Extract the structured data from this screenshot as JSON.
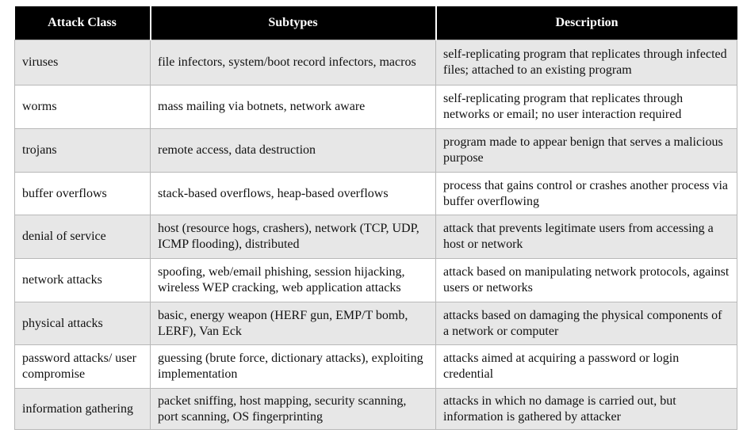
{
  "table": {
    "headers": [
      "Attack Class",
      "Subtypes",
      "Description"
    ],
    "rows": [
      {
        "attack_class": "viruses",
        "subtypes": "file infectors, system/boot record infectors, macros",
        "description": "self-replicating program that replicates through infected files; attached to an existing program"
      },
      {
        "attack_class": "worms",
        "subtypes": "mass mailing via botnets, network aware",
        "description": "self-replicating program that replicates through networks or email; no user interaction required"
      },
      {
        "attack_class": "trojans",
        "subtypes": "remote access, data destruction",
        "description": "program made to appear benign that serves a malicious purpose"
      },
      {
        "attack_class": "buffer overflows",
        "subtypes": "stack-based overflows, heap-based overflows",
        "description": "process that gains control or crashes another process via buffer overflowing"
      },
      {
        "attack_class": "denial of service",
        "subtypes": "host (resource hogs, crashers), network (TCP, UDP, ICMP flooding), distributed",
        "description": "attack that prevents legitimate users from accessing a host or network"
      },
      {
        "attack_class": "network attacks",
        "subtypes": "spoofing, web/email phishing, session hijacking, wireless WEP cracking, web application attacks",
        "description": "attack based on manipulating network protocols, against users or networks"
      },
      {
        "attack_class": "physical attacks",
        "subtypes": "basic, energy weapon (HERF gun, EMP/T bomb, LERF), Van Eck",
        "description": "attacks based on damaging the physical components of a network or computer"
      },
      {
        "attack_class": "password attacks/ user compromise",
        "subtypes": "guessing (brute force, dictionary attacks), exploiting implementation",
        "description": "attacks aimed at acquiring a password or login credential"
      },
      {
        "attack_class": "information gathering",
        "subtypes": "packet sniffing, host mapping, security scanning, port scanning, OS fingerprinting",
        "description": "attacks in which no damage is carried out, but information is gathered by attacker"
      }
    ]
  },
  "colors": {
    "header_background": "#000000",
    "header_text": "#ffffff",
    "row_shade": "#e7e7e7",
    "row_plain": "#ffffff",
    "border": "#b8b8b8"
  }
}
